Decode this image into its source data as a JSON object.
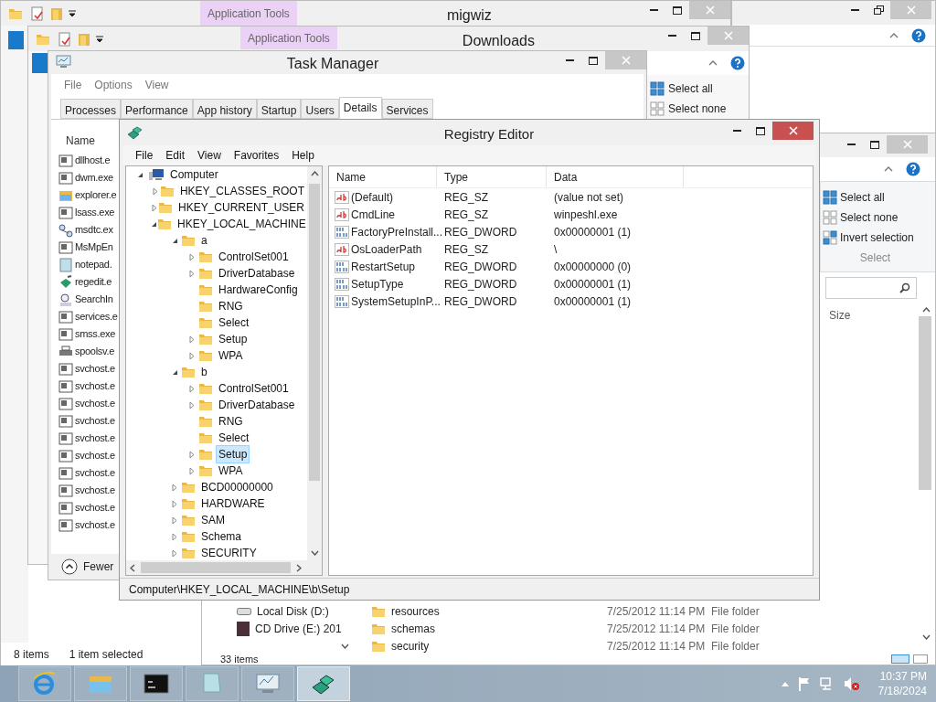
{
  "migwiz": {
    "title": "migwiz",
    "context_tab": "Application Tools",
    "status": [
      "8 items",
      "1 item selected"
    ]
  },
  "downloads": {
    "title": "Downloads",
    "context_tab": "Application Tools",
    "ribbon_items": [
      {
        "label": "Select all",
        "kind": "all"
      },
      {
        "label": "Select none",
        "kind": "none"
      }
    ]
  },
  "explorer": {
    "ribbon_items": [
      {
        "label": "Select all",
        "kind": "all"
      },
      {
        "label": "Select none",
        "kind": "none"
      },
      {
        "label": "Invert selection",
        "kind": "invert"
      }
    ],
    "ribbon_group": "Select",
    "column": "Size",
    "nav_items": [
      {
        "label": "Local Disk (D:)",
        "kind": "disk"
      },
      {
        "label": "CD Drive (E:) 201",
        "kind": "cd"
      }
    ],
    "files": [
      {
        "name": "resources",
        "date": "7/25/2012 11:14 PM",
        "type": "File folder"
      },
      {
        "name": "schemas",
        "date": "7/25/2012 11:14 PM",
        "type": "File folder"
      },
      {
        "name": "security",
        "date": "7/25/2012 11:14 PM",
        "type": "File folder"
      }
    ],
    "status": "33 items"
  },
  "task_manager": {
    "title": "Task Manager",
    "menu": [
      "File",
      "Options",
      "View"
    ],
    "tabs": [
      {
        "label": "Processes",
        "selected": false
      },
      {
        "label": "Performance",
        "selected": false
      },
      {
        "label": "App history",
        "selected": false
      },
      {
        "label": "Startup",
        "selected": false
      },
      {
        "label": "Users",
        "selected": false
      },
      {
        "label": "Details",
        "selected": true
      },
      {
        "label": "Services",
        "selected": false
      }
    ],
    "column": "Name",
    "processes": [
      {
        "name": "dllhost.e",
        "kind": "exe"
      },
      {
        "name": "dwm.exe",
        "kind": "exe"
      },
      {
        "name": "explorer.e",
        "kind": "explorer"
      },
      {
        "name": "lsass.exe",
        "kind": "exe"
      },
      {
        "name": "msdtc.ex",
        "kind": "service"
      },
      {
        "name": "MsMpEn",
        "kind": "exe"
      },
      {
        "name": "notepad.",
        "kind": "notepad"
      },
      {
        "name": "regedit.e",
        "kind": "regedit"
      },
      {
        "name": "SearchIn",
        "kind": "search"
      },
      {
        "name": "services.e",
        "kind": "exe"
      },
      {
        "name": "smss.exe",
        "kind": "exe"
      },
      {
        "name": "spoolsv.e",
        "kind": "printer"
      },
      {
        "name": "svchost.e",
        "kind": "exe"
      },
      {
        "name": "svchost.e",
        "kind": "exe"
      },
      {
        "name": "svchost.e",
        "kind": "exe"
      },
      {
        "name": "svchost.e",
        "kind": "exe"
      },
      {
        "name": "svchost.e",
        "kind": "exe"
      },
      {
        "name": "svchost.e",
        "kind": "exe"
      },
      {
        "name": "svchost.e",
        "kind": "exe"
      },
      {
        "name": "svchost.e",
        "kind": "exe"
      },
      {
        "name": "svchost.e",
        "kind": "exe"
      },
      {
        "name": "svchost.e",
        "kind": "exe"
      }
    ],
    "toggle": "Fewer"
  },
  "registry_editor": {
    "title": "Registry Editor",
    "menu": [
      "File",
      "Edit",
      "View",
      "Favorites",
      "Help"
    ],
    "tree": [
      {
        "label": "Computer",
        "kind": "computer",
        "expandable": true,
        "expanded": true,
        "selected": false,
        "children": [
          {
            "label": "HKEY_CLASSES_ROOT",
            "kind": "folder",
            "expandable": true,
            "expanded": false,
            "selected": false
          },
          {
            "label": "HKEY_CURRENT_USER",
            "kind": "folder",
            "expandable": true,
            "expanded": false,
            "selected": false
          },
          {
            "label": "HKEY_LOCAL_MACHINE",
            "kind": "folder",
            "expandable": true,
            "expanded": true,
            "selected": false,
            "children": [
              {
                "label": "a",
                "kind": "folder",
                "expandable": true,
                "expanded": true,
                "selected": false,
                "children": [
                  {
                    "label": "ControlSet001",
                    "kind": "folder",
                    "expandable": true,
                    "expanded": false,
                    "selected": false
                  },
                  {
                    "label": "DriverDatabase",
                    "kind": "folder",
                    "expandable": true,
                    "expanded": false,
                    "selected": false
                  },
                  {
                    "label": "HardwareConfig",
                    "kind": "folder",
                    "expandable": false,
                    "selected": false
                  },
                  {
                    "label": "RNG",
                    "kind": "folder",
                    "expandable": false,
                    "selected": false
                  },
                  {
                    "label": "Select",
                    "kind": "folder",
                    "expandable": false,
                    "selected": false
                  },
                  {
                    "label": "Setup",
                    "kind": "folder",
                    "expandable": true,
                    "expanded": false,
                    "selected": false
                  },
                  {
                    "label": "WPA",
                    "kind": "folder",
                    "expandable": true,
                    "expanded": false,
                    "selected": false
                  }
                ]
              },
              {
                "label": "b",
                "kind": "folder",
                "expandable": true,
                "expanded": true,
                "selected": false,
                "children": [
                  {
                    "label": "ControlSet001",
                    "kind": "folder",
                    "expandable": true,
                    "expanded": false,
                    "selected": false
                  },
                  {
                    "label": "DriverDatabase",
                    "kind": "folder",
                    "expandable": true,
                    "expanded": false,
                    "selected": false
                  },
                  {
                    "label": "RNG",
                    "kind": "folder",
                    "expandable": false,
                    "selected": false
                  },
                  {
                    "label": "Select",
                    "kind": "folder",
                    "expandable": false,
                    "selected": false
                  },
                  {
                    "label": "Setup",
                    "kind": "folder",
                    "expandable": true,
                    "expanded": false,
                    "selected": true
                  },
                  {
                    "label": "WPA",
                    "kind": "folder",
                    "expandable": true,
                    "expanded": false,
                    "selected": false
                  }
                ]
              },
              {
                "label": "BCD00000000",
                "kind": "folder",
                "expandable": true,
                "expanded": false,
                "selected": false
              },
              {
                "label": "HARDWARE",
                "kind": "folder",
                "expandable": true,
                "expanded": false,
                "selected": false
              },
              {
                "label": "SAM",
                "kind": "folder",
                "expandable": true,
                "expanded": false,
                "selected": false
              },
              {
                "label": "Schema",
                "kind": "folder",
                "expandable": true,
                "expanded": false,
                "selected": false
              },
              {
                "label": "SECURITY",
                "kind": "folder",
                "expandable": true,
                "expanded": false,
                "selected": false
              }
            ]
          }
        ]
      }
    ],
    "columns": [
      "Name",
      "Type",
      "Data"
    ],
    "values": [
      {
        "name": "(Default)",
        "type": "REG_SZ",
        "data": "(value not set)",
        "kind": "string"
      },
      {
        "name": "CmdLine",
        "type": "REG_SZ",
        "data": "winpeshl.exe",
        "kind": "string"
      },
      {
        "name": "FactoryPreInstall...",
        "type": "REG_DWORD",
        "data": "0x00000001 (1)",
        "kind": "binary"
      },
      {
        "name": "OsLoaderPath",
        "type": "REG_SZ",
        "data": "\\",
        "kind": "string"
      },
      {
        "name": "RestartSetup",
        "type": "REG_DWORD",
        "data": "0x00000000 (0)",
        "kind": "binary"
      },
      {
        "name": "SetupType",
        "type": "REG_DWORD",
        "data": "0x00000001 (1)",
        "kind": "binary"
      },
      {
        "name": "SystemSetupInP...",
        "type": "REG_DWORD",
        "data": "0x00000001 (1)",
        "kind": "binary"
      }
    ],
    "status": "Computer\\HKEY_LOCAL_MACHINE\\b\\Setup"
  },
  "taskbar": {
    "apps": [
      {
        "kind": "ie",
        "selected": false
      },
      {
        "kind": "explorer",
        "selected": false
      },
      {
        "kind": "cmd",
        "selected": false
      },
      {
        "kind": "notepad",
        "selected": false
      },
      {
        "kind": "taskmgr",
        "selected": false
      },
      {
        "kind": "regedit",
        "selected": true
      }
    ],
    "time": "10:37 PM",
    "date": "7/18/2024"
  }
}
